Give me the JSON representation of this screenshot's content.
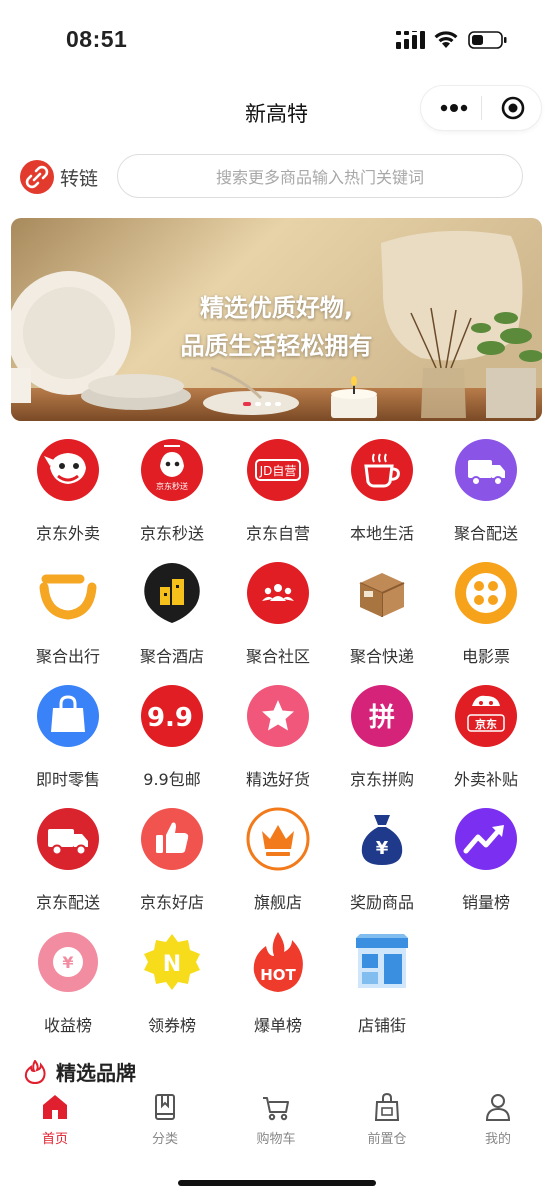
{
  "status_bar": {
    "time": "08:51"
  },
  "nav": {
    "title": "新高特"
  },
  "search": {
    "link_label": "转链",
    "placeholder": "搜索更多商品输入热门关键词"
  },
  "banner": {
    "line1": "精选优质好物,",
    "line2": "品质生活轻松拥有"
  },
  "grid": [
    {
      "label": "京东外卖",
      "icon": "jd-dog-icon",
      "color": "#e01e24"
    },
    {
      "label": "京东秒送",
      "icon": "jd-dog-delivery-icon",
      "color": "#e01e24"
    },
    {
      "label": "京东自营",
      "icon": "jd-self-operated-icon",
      "color": "#e01e24"
    },
    {
      "label": "本地生活",
      "icon": "coffee-cup-icon",
      "color": "#e01e24"
    },
    {
      "label": "聚合配送",
      "icon": "truck-icon",
      "color": "#8a55e6"
    },
    {
      "label": "聚合出行",
      "icon": "didi-icon",
      "color": "#f5a623"
    },
    {
      "label": "聚合酒店",
      "icon": "hotel-icon",
      "color": "#1c1c1c"
    },
    {
      "label": "聚合社区",
      "icon": "community-icon",
      "color": "#e01e24"
    },
    {
      "label": "聚合快递",
      "icon": "parcel-box-icon",
      "color": "#b07a4a"
    },
    {
      "label": "电影票",
      "icon": "film-reel-icon",
      "color": "#f7a21b"
    },
    {
      "label": "即时零售",
      "icon": "shopping-bag-icon",
      "color": "#3a82f7"
    },
    {
      "label": "9.9包邮",
      "icon": "nine-nine-icon",
      "color": "#e01e24"
    },
    {
      "label": "精选好货",
      "icon": "star-badge-icon",
      "color": "#f0577a"
    },
    {
      "label": "京东拼购",
      "icon": "pin-icon",
      "color": "#d6237a"
    },
    {
      "label": "外卖补贴",
      "icon": "jd-dog-badge-icon",
      "color": "#e01e24"
    },
    {
      "label": "京东配送",
      "icon": "delivery-truck-icon",
      "color": "#d9232d"
    },
    {
      "label": "京东好店",
      "icon": "thumbs-up-icon",
      "color": "#f1544f"
    },
    {
      "label": "旗舰店",
      "icon": "crown-icon",
      "color": "#f27a1a"
    },
    {
      "label": "奖励商品",
      "icon": "money-bag-icon",
      "color": "#1f3a8a"
    },
    {
      "label": "销量榜",
      "icon": "trend-up-icon",
      "color": "#7b2ff0"
    },
    {
      "label": "收益榜",
      "icon": "yen-coin-icon",
      "color": "#f28ca0"
    },
    {
      "label": "领券榜",
      "icon": "coupon-n-icon",
      "color": "#f6dc1b"
    },
    {
      "label": "爆单榜",
      "icon": "hot-fire-icon",
      "color": "#ef3b2c"
    },
    {
      "label": "店铺街",
      "icon": "storefront-icon",
      "color": "#3b8fe0"
    }
  ],
  "section": {
    "title": "精选品牌"
  },
  "tabbar": [
    {
      "label": "首页",
      "icon": "home-icon",
      "active": true
    },
    {
      "label": "分类",
      "icon": "book-icon",
      "active": false
    },
    {
      "label": "购物车",
      "icon": "cart-icon",
      "active": false
    },
    {
      "label": "前置仓",
      "icon": "warehouse-bag-icon",
      "active": false
    },
    {
      "label": "我的",
      "icon": "user-icon",
      "active": false
    }
  ],
  "colors": {
    "brand_red": "#e0202e",
    "search_border": "#dddddd",
    "tab_inactive": "#888888"
  }
}
